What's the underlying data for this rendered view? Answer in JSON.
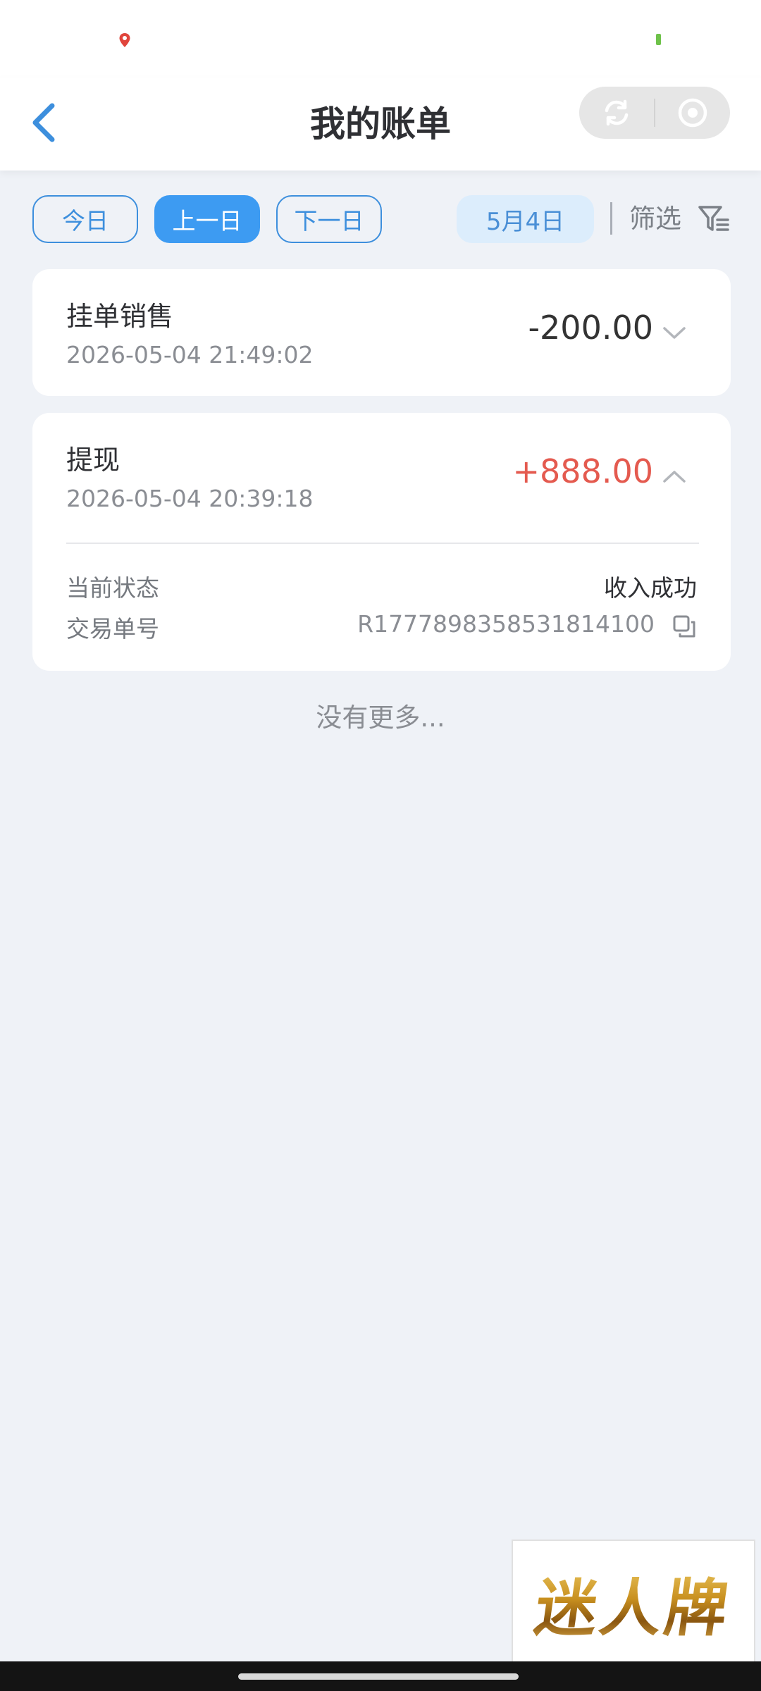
{
  "header": {
    "title": "我的账单"
  },
  "icons": {
    "back": "chevron-left-icon",
    "refresh": "refresh-icon",
    "close": "target-close-icon",
    "filter": "funnel-filter-icon",
    "copy": "copy-icon",
    "chevron_down": "chevron-down-icon",
    "chevron_up": "chevron-up-icon"
  },
  "filters": {
    "today": "今日",
    "prev_day": "上一日",
    "next_day": "下一日",
    "active": "prev_day",
    "date": "5月4日",
    "filter_label": "筛选"
  },
  "transactions": [
    {
      "title": "挂单销售",
      "time": "2026-05-04 21:49:02",
      "amount": "-200.00",
      "amount_color": "#333333",
      "expanded": false
    },
    {
      "title": "提现",
      "time": "2026-05-04 20:39:18",
      "amount": "+888.00",
      "amount_color": "#e45a4f",
      "expanded": true,
      "details": {
        "status_label": "当前状态",
        "status_value": "收入成功",
        "order_label": "交易单号",
        "order_value": "R1777898358531814100"
      }
    }
  ],
  "footer": {
    "no_more": "没有更多..."
  },
  "watermark": {
    "text": "迷人牌"
  },
  "colors": {
    "accent": "#3d9bf2",
    "background": "#eff2f7",
    "negative_amount": "#333333",
    "positive_amount": "#e45a4f"
  }
}
